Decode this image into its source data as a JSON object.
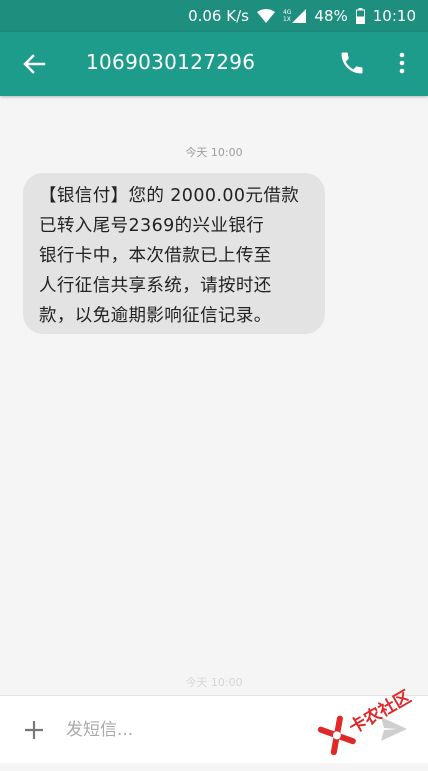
{
  "status_bar": {
    "speed": "0.06 K/s",
    "network_top": "4G",
    "network_bottom": "1X",
    "battery": "48%",
    "time": "10:10"
  },
  "toolbar": {
    "title": "1069030127296",
    "back_icon": "arrow-left-icon",
    "call_icon": "phone-icon",
    "more_icon": "more-vert-icon"
  },
  "conversation": {
    "timestamp": "今天 10:00",
    "message_lines": [
      "【银信付】您的 2000.00元借款",
      "已转入尾号2369的兴业银行",
      "银行卡中，本次借款已上传至",
      "人行征信共享系统，请按时还",
      "款，以免逾期影响征信记录。"
    ],
    "faded_timestamp": "今天 10:00"
  },
  "composer": {
    "placeholder": "发短信...",
    "add_icon": "plus-icon",
    "send_icon": "send-icon"
  },
  "watermark": {
    "text": "卡农社区"
  },
  "colors": {
    "status_bar": "#1e8e7f",
    "toolbar": "#1e9c8b",
    "bubble": "#e3e3e3",
    "background": "#f5f5f5",
    "watermark": "#e02828"
  }
}
